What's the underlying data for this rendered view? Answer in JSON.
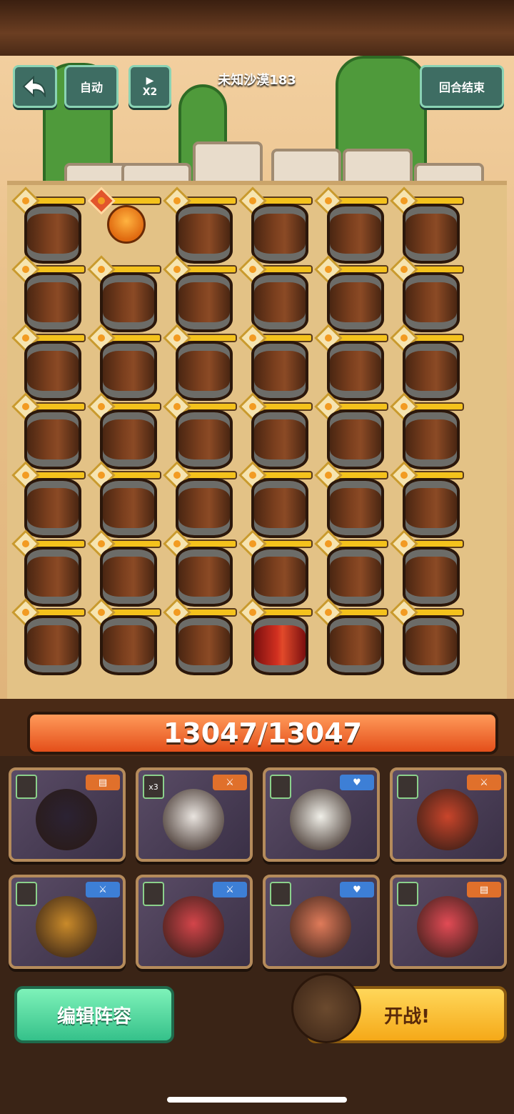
{
  "hud": {
    "back_icon": "back-arrow-icon",
    "auto_label": "自动",
    "speed_label": "X2",
    "speed_icon": "play-icon",
    "end_turn_label": "回合结束",
    "stage_title": "未知沙漠183"
  },
  "board": {
    "rows": 7,
    "cols": 6,
    "special": [
      {
        "row": 0,
        "col": 1,
        "type": "enemy-sprite",
        "alert": true
      },
      {
        "row": 6,
        "col": 3,
        "type": "red-barrel"
      }
    ]
  },
  "hp": {
    "current": 13047,
    "max": 13047,
    "text": "13047/13047"
  },
  "heroes": [
    {
      "tag": "",
      "class_icon": "rank-icon",
      "class_color": "#e0702b"
    },
    {
      "tag": "x3",
      "class_icon": "sword-icon",
      "class_color": "#e0702b"
    },
    {
      "tag": "",
      "class_icon": "heart-icon",
      "class_color": "#3d7fd6"
    },
    {
      "tag": "",
      "class_icon": "sword-icon",
      "class_color": "#e0702b"
    },
    {
      "tag": "",
      "class_icon": "sword-icon",
      "class_color": "#3d7fd6"
    },
    {
      "tag": "",
      "class_icon": "sword-icon",
      "class_color": "#3d7fd6"
    },
    {
      "tag": "",
      "class_icon": "heart-icon",
      "class_color": "#3d7fd6"
    },
    {
      "tag": "",
      "class_icon": "rank-icon",
      "class_color": "#e0702b"
    }
  ],
  "buttons": {
    "edit_label": "编辑阵容",
    "fight_label": "开战!"
  }
}
